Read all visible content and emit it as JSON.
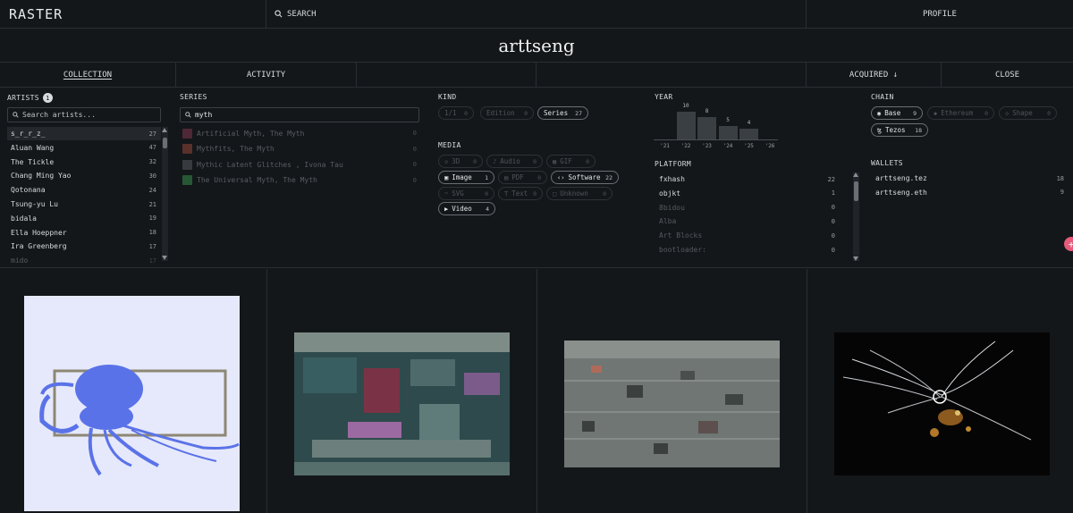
{
  "topbar": {
    "logo": "RASTER",
    "search_label": "SEARCH",
    "profile_label": "PROFILE"
  },
  "page_title": "arttseng",
  "tabs": {
    "collection": "COLLECTION",
    "activity": "ACTIVITY",
    "sort": "ACQUIRED ↓",
    "close": "CLOSE"
  },
  "artists": {
    "header": "ARTISTS",
    "selected_count": "1",
    "search_placeholder": "Search artists...",
    "items": [
      {
        "name": "s_r_r_z_",
        "count": "27"
      },
      {
        "name": "Aluan Wang",
        "count": "47"
      },
      {
        "name": "The Tickle",
        "count": "32"
      },
      {
        "name": "Chang Ming Yao",
        "count": "30"
      },
      {
        "name": "Qotonana",
        "count": "24"
      },
      {
        "name": "Tsung-yu Lu",
        "count": "21"
      },
      {
        "name": "bidala",
        "count": "19"
      },
      {
        "name": "Ella Hoeppner",
        "count": "18"
      },
      {
        "name": "Ira Greenberg",
        "count": "17"
      },
      {
        "name": "mido",
        "count": "17"
      }
    ]
  },
  "series": {
    "header": "SERIES",
    "search_value": "myth",
    "items": [
      {
        "name": "Artificial Myth, The Myth",
        "count": "0"
      },
      {
        "name": "Mythfits, The Myth",
        "count": "0"
      },
      {
        "name": "Mythic Latent Glitches , Ivona Tau",
        "count": "0"
      },
      {
        "name": "The Universal Myth, The Myth",
        "count": "0"
      }
    ]
  },
  "kind": {
    "header": "KIND",
    "items": [
      {
        "label": "1/1",
        "count": "0",
        "active": false
      },
      {
        "label": "Edition",
        "count": "0",
        "active": false
      },
      {
        "label": "Series",
        "count": "27",
        "active": true
      }
    ]
  },
  "media": {
    "header": "MEDIA",
    "items": [
      {
        "label": "3D",
        "count": "0",
        "icon": "cube-icon"
      },
      {
        "label": "Audio",
        "count": "0",
        "icon": "audio-icon"
      },
      {
        "label": "GIF",
        "count": "0",
        "icon": "gif-icon"
      },
      {
        "label": "Image",
        "count": "1",
        "icon": "image-icon"
      },
      {
        "label": "PDF",
        "count": "0",
        "icon": "pdf-icon"
      },
      {
        "label": "Software",
        "count": "22",
        "icon": "code-icon"
      },
      {
        "label": "SVG",
        "count": "0",
        "icon": "svg-icon"
      },
      {
        "label": "Text",
        "count": "0",
        "icon": "text-icon"
      },
      {
        "label": "Unknown",
        "count": "0",
        "icon": "unknown-icon"
      },
      {
        "label": "Video",
        "count": "4",
        "icon": "play-icon"
      }
    ]
  },
  "year": {
    "header": "YEAR",
    "chart_data": {
      "type": "bar",
      "categories": [
        "'21",
        "'22",
        "'23",
        "'24",
        "'25",
        "'26"
      ],
      "values": [
        0,
        10,
        8,
        5,
        4,
        0
      ]
    }
  },
  "platform": {
    "header": "PLATFORM",
    "items": [
      {
        "name": "fxhash",
        "count": "22",
        "active": true
      },
      {
        "name": "objkt",
        "count": "1",
        "active": true
      },
      {
        "name": "8bidou",
        "count": "0",
        "active": false
      },
      {
        "name": "Alba",
        "count": "0",
        "active": false
      },
      {
        "name": "Art Blocks",
        "count": "0",
        "active": false
      },
      {
        "name": "bootloader:",
        "count": "0",
        "active": false
      }
    ]
  },
  "chain": {
    "header": "CHAIN",
    "items": [
      {
        "label": "Base",
        "count": "9",
        "active": true
      },
      {
        "label": "Ethereum",
        "count": "0",
        "active": false
      },
      {
        "label": "Shape",
        "count": "0",
        "active": false
      },
      {
        "label": "Tezos",
        "count": "18",
        "active": true
      }
    ]
  },
  "wallets": {
    "header": "WALLETS",
    "items": [
      {
        "name": "arttseng.tez",
        "count": "18"
      },
      {
        "name": "arttseng.eth",
        "count": "9"
      }
    ]
  },
  "colors": {
    "bg": "#14171a",
    "border": "#2a2e32",
    "accent": "#e65a7a"
  }
}
